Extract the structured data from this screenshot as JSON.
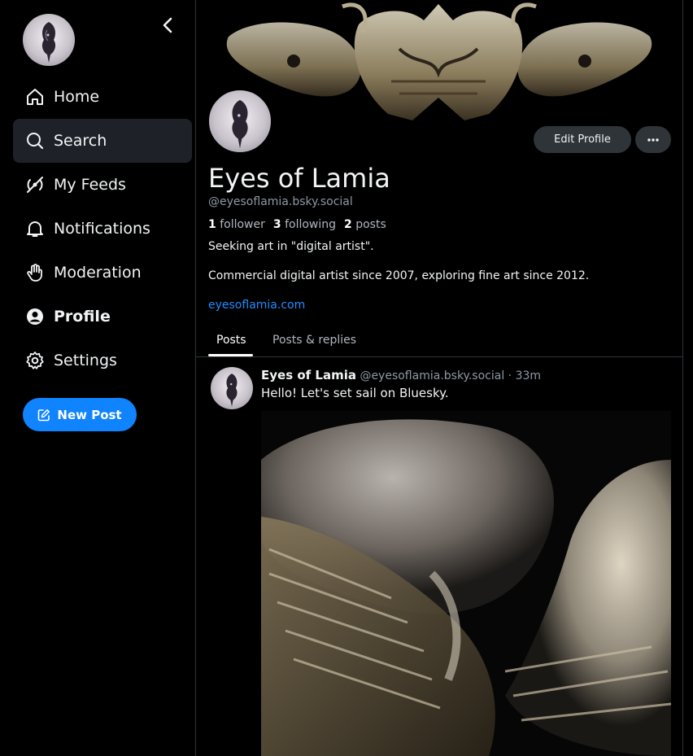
{
  "sidebar": {
    "items": [
      {
        "label": "Home",
        "icon": "home-icon"
      },
      {
        "label": "Search",
        "icon": "search-icon"
      },
      {
        "label": "My Feeds",
        "icon": "feeds-icon"
      },
      {
        "label": "Notifications",
        "icon": "bell-icon"
      },
      {
        "label": "Moderation",
        "icon": "hand-icon"
      },
      {
        "label": "Profile",
        "icon": "user-circle-icon"
      },
      {
        "label": "Settings",
        "icon": "gear-icon"
      }
    ],
    "active": "Search",
    "new_post_label": "New Post"
  },
  "profile": {
    "display_name": "Eyes of Lamia",
    "handle": "@eyesoflamia.bsky.social",
    "followers_count": "1",
    "followers_label": "follower",
    "following_count": "3",
    "following_label": "following",
    "posts_count": "2",
    "posts_label": "posts",
    "bio_line1": "Seeking art in \"digital artist\".",
    "bio_line2": "Commercial digital artist since 2007, exploring fine art since 2012.",
    "link": "eyesoflamia.com",
    "edit_label": "Edit Profile"
  },
  "tabs": [
    "Posts",
    "Posts & replies"
  ],
  "post": {
    "author": "Eyes of Lamia",
    "handle": "@eyesoflamia.bsky.social",
    "time": "· 33m",
    "text": "Hello! Let's set sail on Bluesky."
  },
  "colors": {
    "accent": "#1083fe",
    "link": "#208bfe",
    "active_bg": "#1e2228",
    "border": "#2e3438"
  }
}
